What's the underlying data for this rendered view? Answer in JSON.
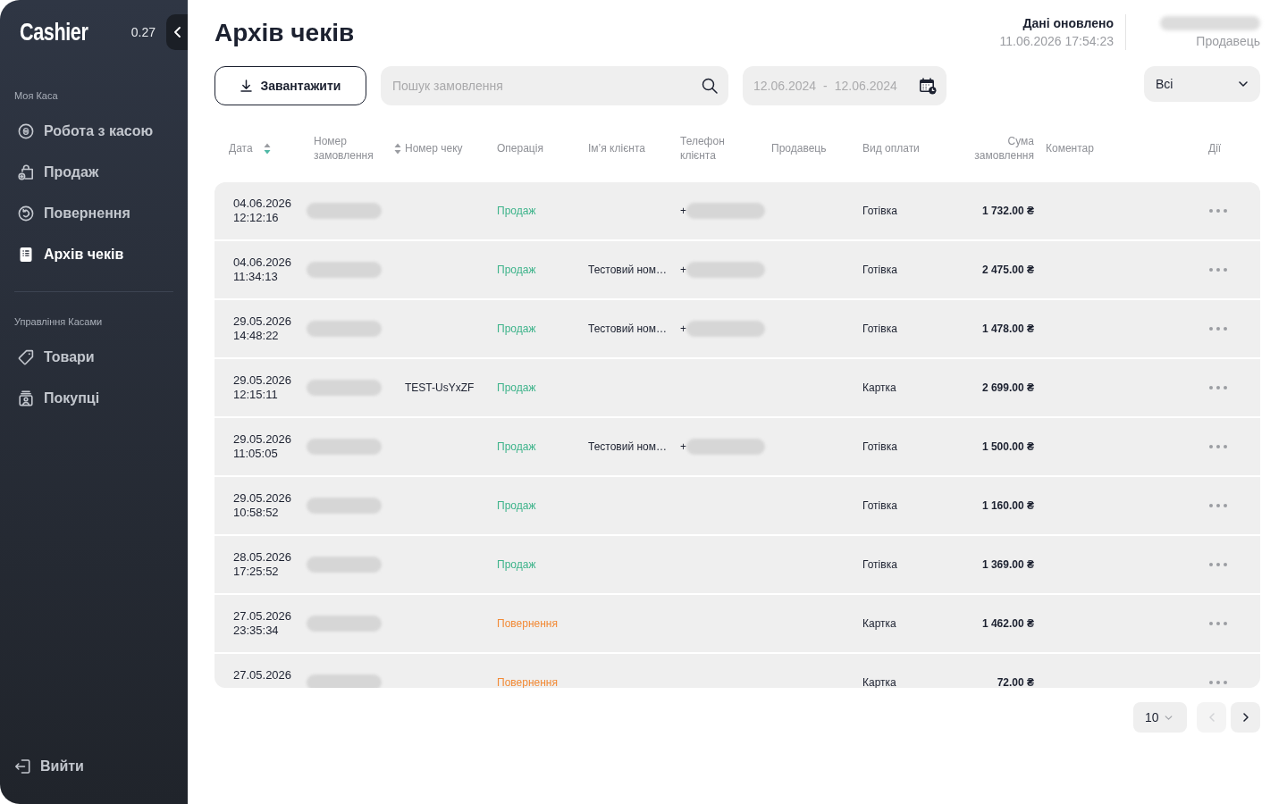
{
  "sidebar": {
    "logo": "Cashier",
    "version": "0.27",
    "sections": [
      {
        "title": "Моя Каса",
        "items": [
          {
            "label": "Робота з касою",
            "selected": false
          },
          {
            "label": "Продаж",
            "selected": false
          },
          {
            "label": "Повернення",
            "selected": false
          },
          {
            "label": "Архів чеків",
            "selected": true
          }
        ]
      },
      {
        "title": "Управління Касами",
        "items": [
          {
            "label": "Товари",
            "selected": false
          },
          {
            "label": "Покупці",
            "selected": false
          }
        ]
      }
    ],
    "logout": "Вийти"
  },
  "header": {
    "title": "Архів чеків",
    "updated_label": "Дані оновлено",
    "updated_at": "11.06.2026 17:54:23",
    "user": {
      "name_hidden": true,
      "role": "Продавець"
    }
  },
  "toolbar": {
    "download_button": "Завантажити",
    "search": {
      "placeholder": "Пошук замовлення"
    },
    "date_range": {
      "from": "12.06.2024",
      "separator": "-",
      "to": "12.06.2024"
    },
    "filter": {
      "value": "Всі"
    }
  },
  "table": {
    "columns": [
      {
        "label": "Дата",
        "sortable": true,
        "sorted": true
      },
      {
        "label": "Номер замовлення",
        "sortable": true,
        "sorted": false
      },
      {
        "label": "Номер чеку",
        "sortable": false
      },
      {
        "label": "Операція",
        "sortable": false
      },
      {
        "label": "Ім’я клієнта",
        "sortable": false
      },
      {
        "label": "Телефон клієнта",
        "sortable": false
      },
      {
        "label": "Продавець",
        "sortable": false
      },
      {
        "label": "Вид оплати",
        "sortable": false
      },
      {
        "label": "Сума замовлення",
        "sortable": false
      },
      {
        "label": "Коментар",
        "sortable": false
      },
      {
        "label": "Дії",
        "sortable": false
      }
    ],
    "rows": [
      {
        "date": "04.06.2026",
        "time": "12:12:16",
        "order_hidden": true,
        "operation": "Продаж",
        "color": "#3db38a",
        "phone": "+",
        "phone_hidden": true,
        "payment": "Готівка",
        "amount": "1 732.00 ₴"
      },
      {
        "date": "04.06.2026",
        "time": "11:34:13",
        "order_hidden": true,
        "operation": "Продаж",
        "color": "#3db38a",
        "client": "Тестовий ном…",
        "phone": "+",
        "phone_hidden": true,
        "payment": "Готівка",
        "amount": "2 475.00 ₴"
      },
      {
        "date": "29.05.2026",
        "time": "14:48:22",
        "order_hidden": true,
        "operation": "Продаж",
        "color": "#3db38a",
        "client": "Тестовий ном…",
        "phone": "+",
        "phone_hidden": true,
        "payment": "Готівка",
        "amount": "1 478.00 ₴"
      },
      {
        "date": "29.05.2026",
        "time": "12:15:11",
        "order_hidden": true,
        "check_number": "TEST-UsYxZF",
        "operation": "Продаж",
        "color": "#3db38a",
        "payment": "Картка",
        "amount": "2 699.00 ₴"
      },
      {
        "date": "29.05.2026",
        "time": "11:05:05",
        "order_hidden": true,
        "operation": "Продаж",
        "color": "#3db38a",
        "client": "Тестовий ном…",
        "phone": "+",
        "phone_hidden": true,
        "payment": "Готівка",
        "amount": "1 500.00 ₴"
      },
      {
        "date": "29.05.2026",
        "time": "10:58:52",
        "order_hidden": true,
        "operation": "Продаж",
        "color": "#3db38a",
        "payment": "Готівка",
        "amount": "1 160.00 ₴"
      },
      {
        "date": "28.05.2026",
        "time": "17:25:52",
        "order_hidden": true,
        "operation": "Продаж",
        "color": "#3db38a",
        "payment": "Готівка",
        "amount": "1 369.00 ₴"
      },
      {
        "date": "27.05.2026",
        "time": "23:35:34",
        "order_hidden": true,
        "operation": "Повернення",
        "color": "#f28a36",
        "payment": "Картка",
        "amount": "1 462.00 ₴"
      },
      {
        "date": "27.05.2026",
        "order_hidden": true,
        "operation": "Повернення",
        "color": "#f28a36",
        "payment": "Картка",
        "amount": "72.00 ₴"
      }
    ]
  },
  "pagination": {
    "page_size": "10",
    "prev": {
      "disabled": true
    },
    "next": {
      "disabled": false
    }
  }
}
